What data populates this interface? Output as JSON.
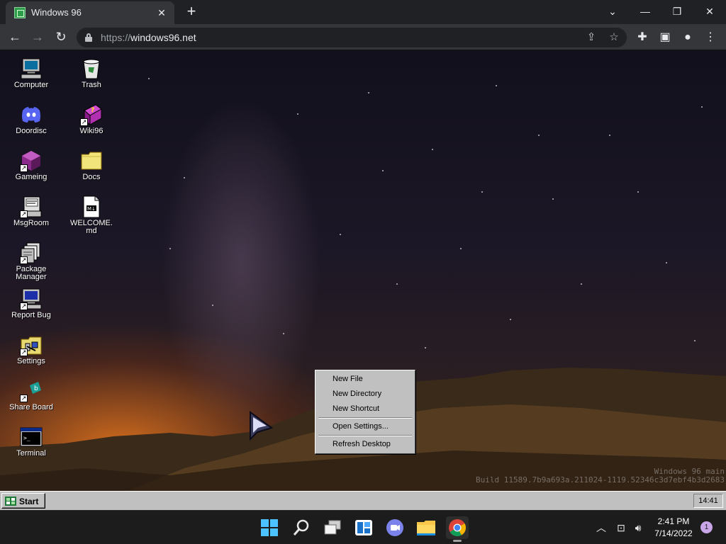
{
  "browser": {
    "tab_title": "Windows 96",
    "tab_close": "✕",
    "new_tab": "+",
    "window_controls": {
      "tab_search": "⌄",
      "minimize": "—",
      "restore": "❐",
      "close": "✕"
    },
    "url_scheme": "https://",
    "url_host": "windows96.net",
    "icons": [
      "back-icon",
      "forward-icon",
      "reload-icon",
      "lock-icon",
      "share-icon",
      "star-icon",
      "extensions-icon",
      "side-panel-icon",
      "profile-icon",
      "menu-icon"
    ]
  },
  "desktop": {
    "icons": [
      {
        "label": "Computer",
        "icon": "computer-icon"
      },
      {
        "label": "Trash",
        "icon": "trash-icon"
      },
      {
        "label": "Doordisc",
        "icon": "discord-icon"
      },
      {
        "label": "Wiki96",
        "icon": "wiki-book-icon"
      },
      {
        "label": "Gameing",
        "icon": "game-cube-icon"
      },
      {
        "label": "Docs",
        "icon": "folder-icon"
      },
      {
        "label": "MsgRoom",
        "icon": "message-room-icon"
      },
      {
        "label": "WELCOME.md",
        "icon": "markdown-file-icon"
      },
      {
        "label": "Package Manager",
        "icon": "package-manager-icon"
      },
      {
        "label": "Report Bug",
        "icon": "report-bug-icon"
      },
      {
        "label": "Settings",
        "icon": "settings-folder-icon"
      },
      {
        "label": "Share Board",
        "icon": "share-board-icon"
      },
      {
        "label": "Terminal",
        "icon": "terminal-icon"
      }
    ],
    "watermark_line1": "Windows 96 main",
    "watermark_line2": "Build 11589.7b9a693a.211024-1119.52346c3d7ebf4b3d2683"
  },
  "context_menu": {
    "items": [
      "New File",
      "New Directory",
      "New Shortcut",
      "Open Settings...",
      "Refresh Desktop"
    ]
  },
  "w96_taskbar": {
    "start_label": "Start",
    "clock": "14:41"
  },
  "win11_taskbar": {
    "apps": [
      "windows-start-icon",
      "search-icon",
      "task-view-icon",
      "widgets-icon",
      "teams-chat-icon",
      "file-explorer-icon",
      "chrome-icon"
    ],
    "tray": [
      "chevron-up-icon",
      "network-icon",
      "volume-icon"
    ],
    "time": "2:41 PM",
    "date": "7/14/2022",
    "notification_count": "1"
  }
}
